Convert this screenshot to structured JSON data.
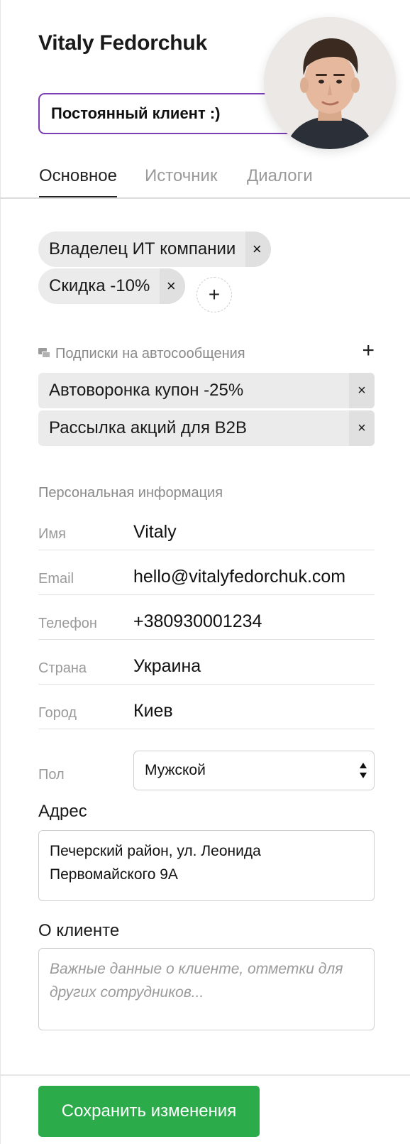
{
  "profile": {
    "name": "Vitaly Fedorchuk",
    "status_value": "Постоянный клиент :)"
  },
  "tabs": [
    {
      "label": "Основное",
      "active": true
    },
    {
      "label": "Источник",
      "active": false
    },
    {
      "label": "Диалоги",
      "active": false
    }
  ],
  "tags": [
    {
      "label": "Владелец ИТ компании",
      "remove_icon": "×"
    },
    {
      "label": "Скидка -10%",
      "remove_icon": "×"
    }
  ],
  "tag_add_icon": "+",
  "subscriptions": {
    "title": "Подписки на автосообщения",
    "add_icon": "+",
    "items": [
      {
        "label": "Автоворонка купон -25%",
        "remove_icon": "×"
      },
      {
        "label": "Рассылка акций для B2B",
        "remove_icon": "×"
      }
    ]
  },
  "personal_info": {
    "title": "Персональная информация",
    "fields": [
      {
        "label": "Имя",
        "value": "Vitaly"
      },
      {
        "label": "Email",
        "value": "hello@vitalyfedorchuk.com"
      },
      {
        "label": "Телефон",
        "value": "+380930001234"
      },
      {
        "label": "Страна",
        "value": "Украина"
      },
      {
        "label": "Город",
        "value": "Киев"
      }
    ],
    "gender": {
      "label": "Пол",
      "selected": "Мужской"
    }
  },
  "address": {
    "label": "Адрес",
    "value": "Печерский район, ул. Леонида Первомайского 9А"
  },
  "about": {
    "label": "О клиенте",
    "placeholder": "Важные данные о клиенте, отметки для других сотрудников..."
  },
  "save_button": "Сохранить изменения",
  "colors": {
    "accent_purple": "#7b3fb3",
    "save_green": "#2bab4a",
    "tag_bg": "#ebebeb"
  }
}
